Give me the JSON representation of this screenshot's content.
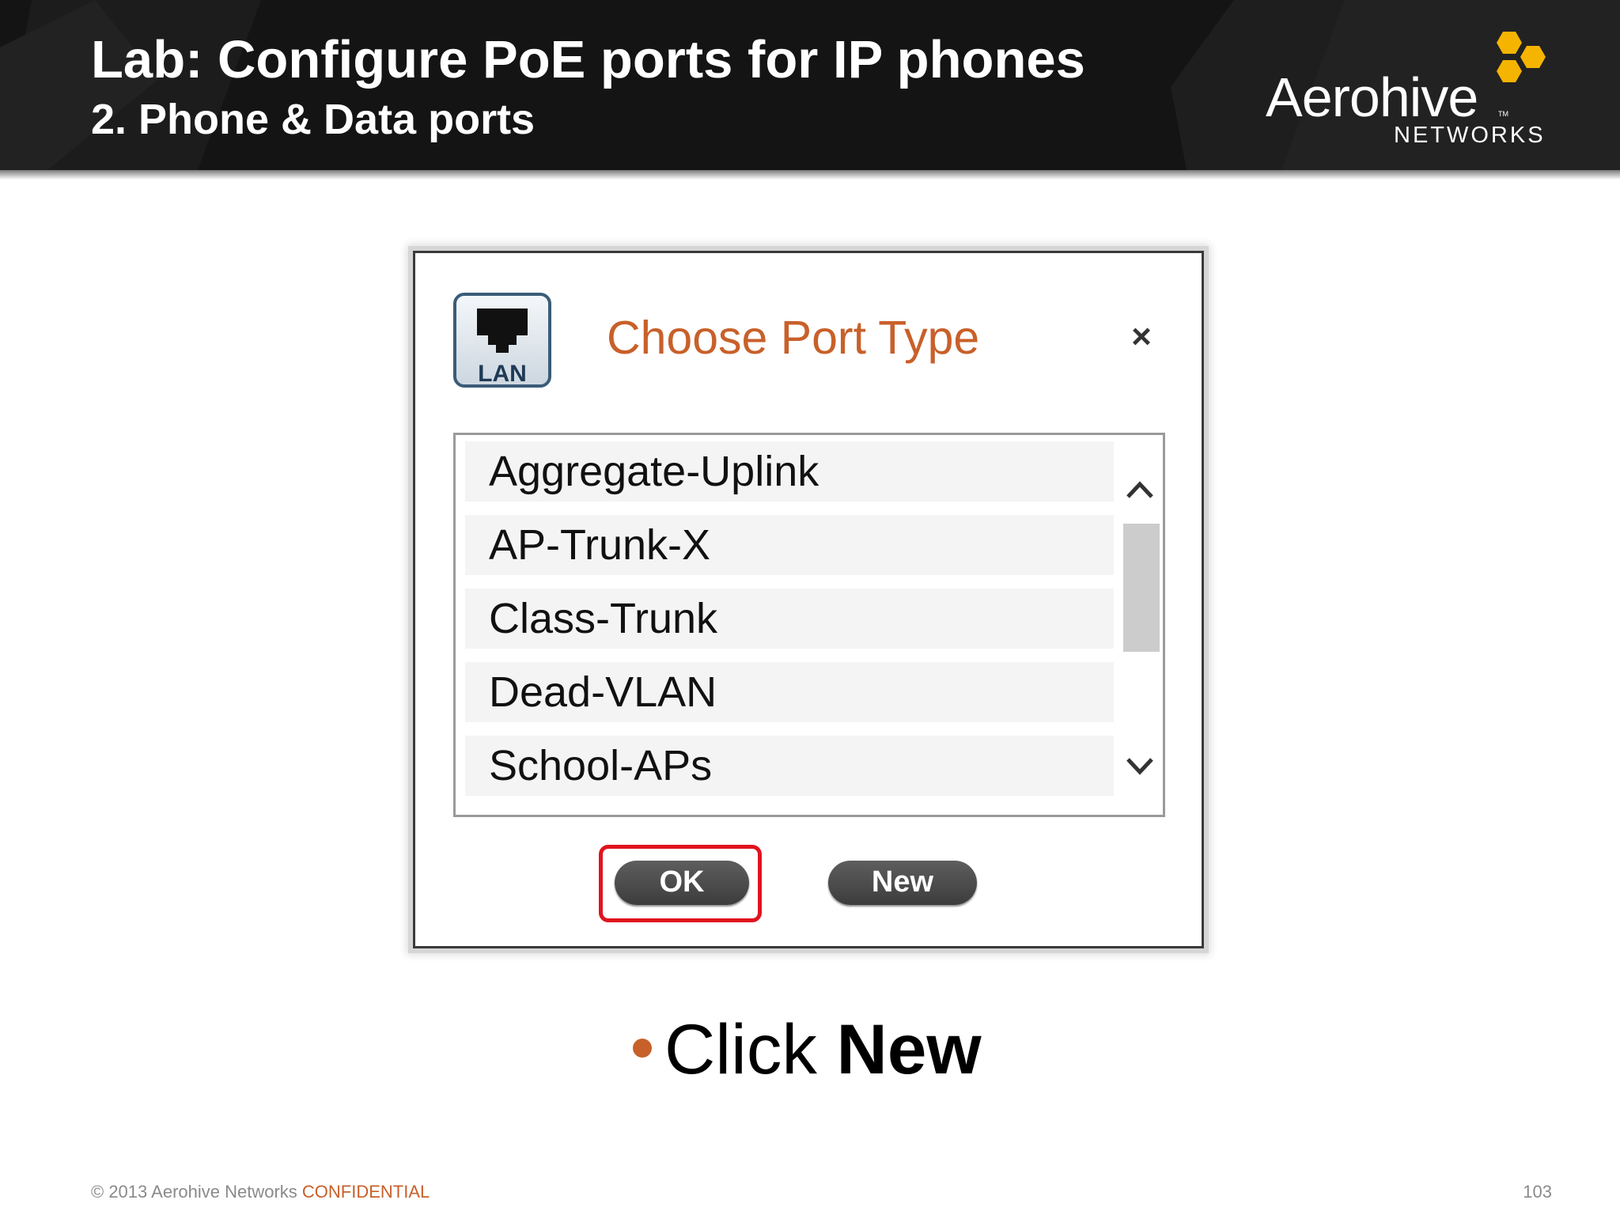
{
  "header": {
    "title": "Lab: Configure PoE ports for IP phones",
    "subtitle": "2. Phone & Data ports"
  },
  "logo": {
    "wordmark": "Aerohive",
    "tm": "TM",
    "sub": "NETWORKS",
    "accent_color": "#f5b400"
  },
  "dialog": {
    "icon_label": "LAN",
    "title": "Choose Port Type",
    "close_glyph": "×",
    "port_types": [
      "Aggregate-Uplink",
      "AP-Trunk-X",
      "Class-Trunk",
      "Dead-VLAN",
      "School-APs"
    ],
    "ok_label": "OK",
    "new_label": "New",
    "highlight_color": "#e0141e"
  },
  "bullet": {
    "text_prefix": "Click ",
    "text_bold": "New"
  },
  "footer": {
    "copyright": "© 2013 Aerohive Networks ",
    "confidential": "CONFIDENTIAL",
    "page_number": "103"
  },
  "colors": {
    "banner": "#141414",
    "accent_orange": "#c8602a"
  }
}
